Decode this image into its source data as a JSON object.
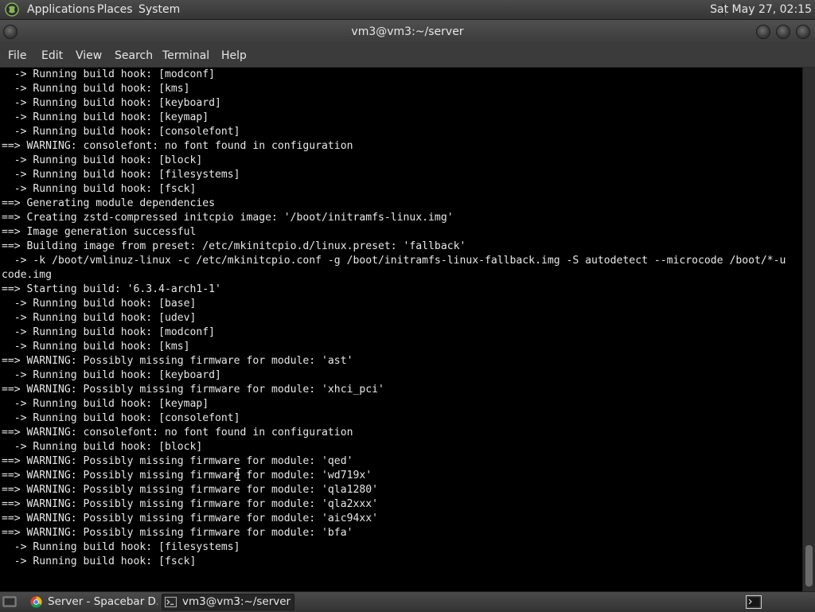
{
  "top_panel": {
    "menus": [
      "Applications",
      "Places",
      "System"
    ],
    "clock": "Sat May 27, 02:15"
  },
  "window": {
    "title": "vm3@vm3:~/server"
  },
  "menu_bar": {
    "items": [
      "File",
      "Edit",
      "View",
      "Search",
      "Terminal",
      "Help"
    ]
  },
  "terminal": {
    "lines": [
      "  -> Running build hook: [modconf]",
      "  -> Running build hook: [kms]",
      "  -> Running build hook: [keyboard]",
      "  -> Running build hook: [keymap]",
      "  -> Running build hook: [consolefont]",
      "==> WARNING: consolefont: no font found in configuration",
      "  -> Running build hook: [block]",
      "  -> Running build hook: [filesystems]",
      "  -> Running build hook: [fsck]",
      "==> Generating module dependencies",
      "==> Creating zstd-compressed initcpio image: '/boot/initramfs-linux.img'",
      "==> Image generation successful",
      "==> Building image from preset: /etc/mkinitcpio.d/linux.preset: 'fallback'",
      "  -> -k /boot/vmlinuz-linux -c /etc/mkinitcpio.conf -g /boot/initramfs-linux-fallback.img -S autodetect --microcode /boot/*-u",
      "code.img",
      "==> Starting build: '6.3.4-arch1-1'",
      "  -> Running build hook: [base]",
      "  -> Running build hook: [udev]",
      "  -> Running build hook: [modconf]",
      "  -> Running build hook: [kms]",
      "==> WARNING: Possibly missing firmware for module: 'ast'",
      "  -> Running build hook: [keyboard]",
      "==> WARNING: Possibly missing firmware for module: 'xhci_pci'",
      "  -> Running build hook: [keymap]",
      "  -> Running build hook: [consolefont]",
      "==> WARNING: consolefont: no font found in configuration",
      "  -> Running build hook: [block]",
      "==> WARNING: Possibly missing firmware for module: 'qed'",
      "==> WARNING: Possibly missing firmware for module: 'wd719x'",
      "==> WARNING: Possibly missing firmware for module: 'qla1280'",
      "==> WARNING: Possibly missing firmware for module: 'qla2xxx'",
      "==> WARNING: Possibly missing firmware for module: 'aic94xx'",
      "==> WARNING: Possibly missing firmware for module: 'bfa'",
      "  -> Running build hook: [filesystems]",
      "  -> Running build hook: [fsck]"
    ]
  },
  "taskbar": {
    "tasks": [
      {
        "label": "Server - Spacebar D...",
        "icon": "chrome-icon"
      },
      {
        "label": "vm3@vm3:~/server",
        "icon": "terminal-icon"
      }
    ]
  },
  "colors": {
    "terminal_bg": "#000000",
    "terminal_fg": "#e8e8e8",
    "panel_bg": "#3b3b3b"
  }
}
